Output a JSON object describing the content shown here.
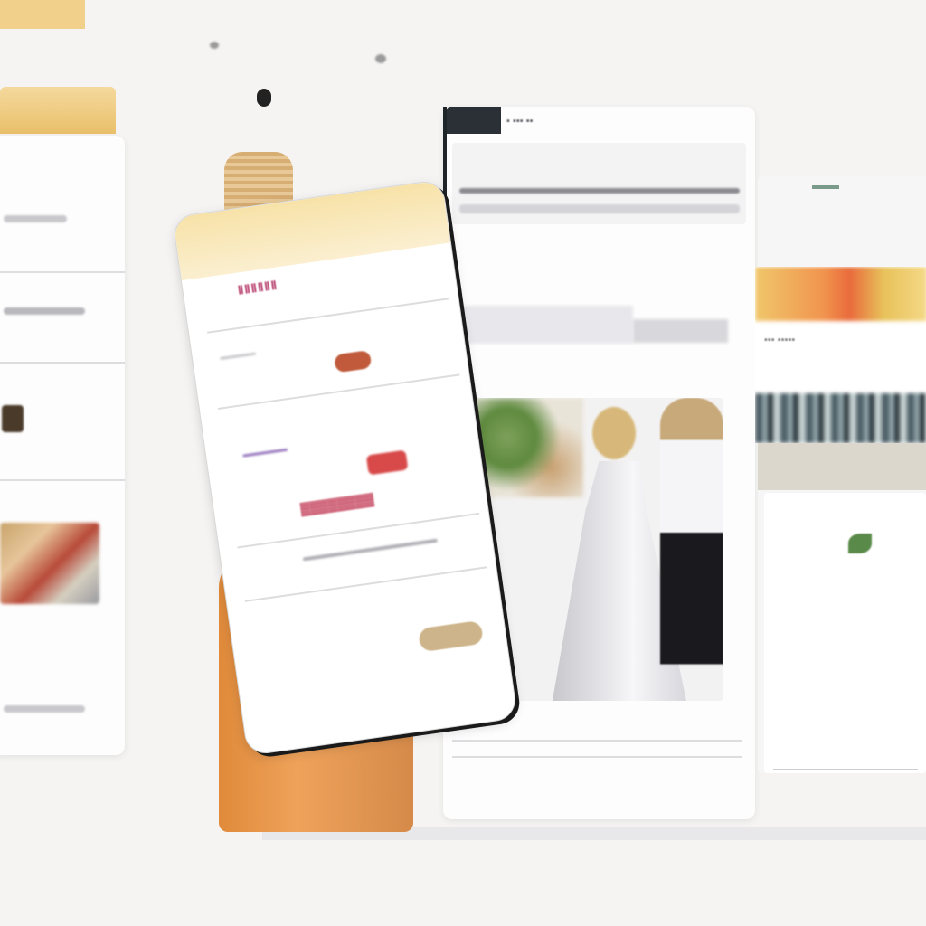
{
  "scene": {
    "description_label": "",
    "colors": {
      "background": "#f5f4f3",
      "phone_header": "#f7e2a8",
      "phone_accent": "#b63a6a",
      "hand": "#e08a3a",
      "monitor_edge": "#1f2428"
    }
  },
  "phone": {
    "title_text": "ⅡⅡⅡⅡⅡⅡ",
    "promo_text": "▓▓▓▓▓▓▓▓"
  },
  "monitor": {
    "header_text": "▪ ▪▪▪ ▪▪"
  },
  "right_banner": {
    "text": "▪▪▪ ▪▪▪▪▪"
  },
  "icons": [
    "food-icon",
    "leaf-icon",
    "home-button-icon"
  ]
}
